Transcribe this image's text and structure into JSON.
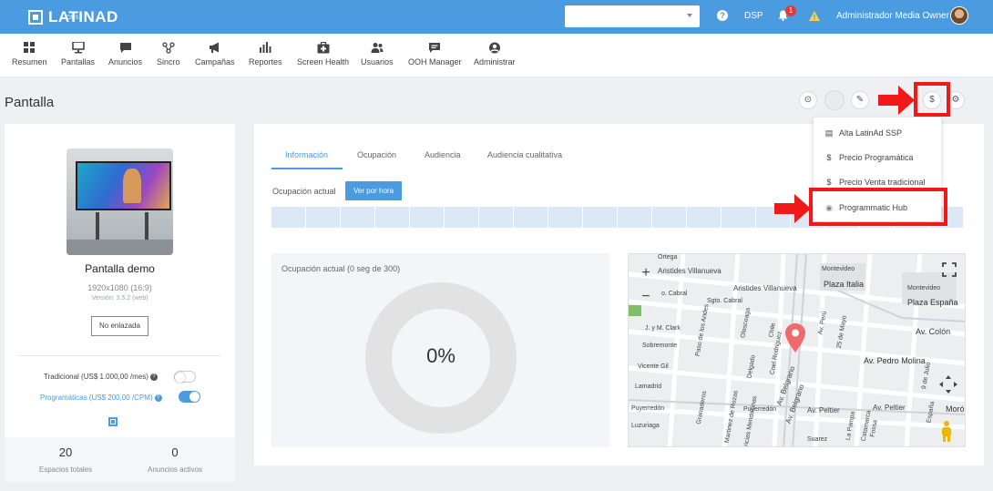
{
  "topbar": {
    "logo": "LATINAD",
    "logo_sub": "CMS",
    "help": "?",
    "dsp": "DSP",
    "notifications": "1",
    "user": "Administrador Media Owner"
  },
  "nav": [
    {
      "label": "Resumen",
      "icon": "grid-icon"
    },
    {
      "label": "Pantallas",
      "icon": "monitor-icon"
    },
    {
      "label": "Anuncios",
      "icon": "chat-icon"
    },
    {
      "label": "Sincro",
      "icon": "sync-nodes-icon"
    },
    {
      "label": "Campañas",
      "icon": "megaphone-icon"
    },
    {
      "label": "Reportes",
      "icon": "bar-chart-icon"
    },
    {
      "label": "Screen Health",
      "icon": "medkit-icon"
    },
    {
      "label": "Usuarios",
      "icon": "users-icon"
    },
    {
      "label": "OOH Manager",
      "icon": "message-box-icon"
    },
    {
      "label": "Administrar",
      "icon": "user-circle-icon"
    }
  ],
  "page": {
    "title": "Pantalla",
    "tools": {
      "clock": "⊙",
      "edit": "✎",
      "price": "$",
      "settings": "⚙"
    }
  },
  "screen": {
    "name": "Pantalla demo",
    "resolution": "1920x1080 (16:9)",
    "version": "Versión: 3.5.2 (web)",
    "link_button": "No enlazada",
    "traditional_label": "Tradicional (US$ 1.000,00 /mes)",
    "traditional_on": false,
    "programmatic_label": "Programáticas (US$ 200,00 /CPM)",
    "programmatic_on": true,
    "stats": [
      {
        "value": "20",
        "label": "Espacios totales"
      },
      {
        "value": "0",
        "label": "Anuncios activos"
      }
    ]
  },
  "tabs": [
    "Información",
    "Ocupación",
    "Audiencia",
    "Audiencia cualitativa"
  ],
  "occupancy": {
    "label": "Ocupación actual",
    "button": "Ver por hora",
    "chart_title": "Ocupación actual (0 seg de 300)",
    "percent_text": "0%",
    "percent_value": 0
  },
  "map": {
    "zoom_in": "+",
    "zoom_out": "−",
    "labels": [
      "Ortega",
      "Aristides Villanueva",
      "Aristides Villanueva",
      "Montevideo",
      "Plaza Italia",
      "Montevideo",
      "Plaza España",
      "o. Cabral",
      "Sgto. Cabral",
      "J. y M. Clark",
      "Av. Colón",
      "Sobremonte",
      "Av. Pedro Molina",
      "Vicente Gil",
      "Lamadrid",
      "Av. Belgrano",
      "Av. Peltier",
      "Av. Peltier",
      "Puyerredón",
      "Puyerredón",
      "Luzuriaga",
      "Suarez",
      "Paso de los Andes",
      "Olascoaga",
      "Chile",
      "Av. Perú",
      "25 de Mayo",
      "Delgado",
      "Cnel Rodriguez",
      "Av. Belgrano",
      "Granaderos",
      "Martinez de Rozas",
      "Patricias Mendocinas",
      "9 de Julio",
      "España",
      "La Pampa",
      "Catamarca",
      "Fossa",
      "Moró"
    ]
  },
  "dropdown": [
    {
      "label": "Alta LatinAd SSP",
      "icon": "document-icon"
    },
    {
      "label": "Precio Programática",
      "icon": "dollar-icon"
    },
    {
      "label": "Precio Venta tradicional",
      "icon": "dollar-icon"
    },
    {
      "label": "Programmatic Hub",
      "icon": "hub-icon"
    }
  ],
  "colors": {
    "primary": "#4a9be0",
    "annotation": "#f01818"
  }
}
